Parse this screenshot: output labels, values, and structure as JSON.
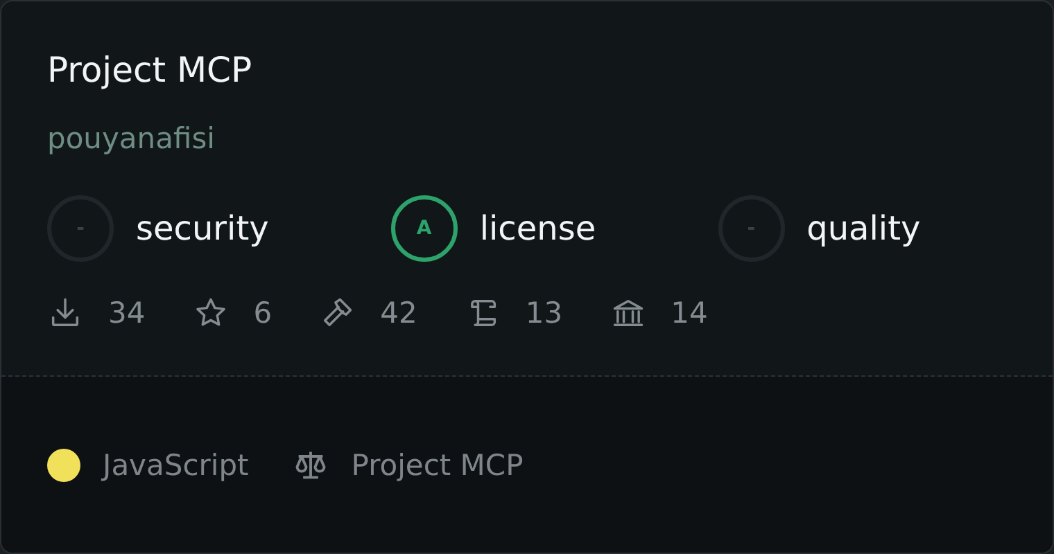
{
  "card": {
    "title": "Project MCP",
    "author": "pouyanafisi",
    "scores": [
      {
        "grade": "-",
        "label": "security",
        "graded": false
      },
      {
        "grade": "A",
        "label": "license",
        "graded": true
      },
      {
        "grade": "-",
        "label": "quality",
        "graded": false
      }
    ],
    "stats": [
      {
        "kind": "downloads",
        "value": "34"
      },
      {
        "kind": "stars",
        "value": "6"
      },
      {
        "kind": "tools",
        "value": "42"
      },
      {
        "kind": "docs",
        "value": "13"
      },
      {
        "kind": "institution",
        "value": "14"
      }
    ],
    "footer": {
      "language": {
        "name": "JavaScript",
        "color": "#f1e05a"
      },
      "license": "Project MCP"
    }
  }
}
